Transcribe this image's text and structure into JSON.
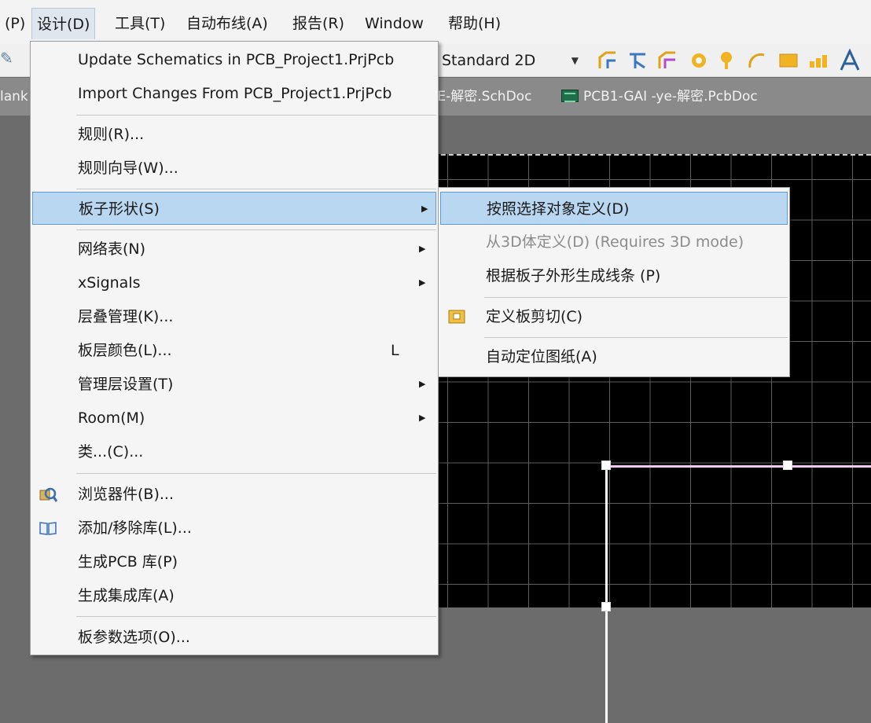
{
  "menubar": {
    "items": [
      {
        "label": "(P)"
      },
      {
        "label": "设计(D)"
      },
      {
        "label": "工具(T)"
      },
      {
        "label": "自动布线(A)"
      },
      {
        "label": "报告(R)"
      },
      {
        "label": "Window"
      },
      {
        "label": "帮助(H)"
      }
    ]
  },
  "toolbar": {
    "view_mode": "Standard 2D",
    "icons": [
      "route-net-icon",
      "route-tee-icon",
      "route-diff-icon",
      "via-icon",
      "pad-icon",
      "arc-icon",
      "fill-icon",
      "region-icon",
      "text-icon"
    ]
  },
  "tabs": {
    "left_fragment": "lank",
    "schdoc": "YE-解密.SchDoc",
    "pcbdoc": "PCB1-GAI -ye-解密.PcbDoc"
  },
  "design_menu": {
    "items": [
      {
        "label": "Update Schematics in PCB_Project1.PrjPcb"
      },
      {
        "label": "Import Changes From PCB_Project1.PrjPcb"
      },
      {
        "label": "规则(R)..."
      },
      {
        "label": "规则向导(W)..."
      },
      {
        "label": "板子形状(S)"
      },
      {
        "label": "网络表(N)"
      },
      {
        "label": "xSignals"
      },
      {
        "label": "层叠管理(K)..."
      },
      {
        "label": "板层颜色(L)...",
        "shortcut": "L"
      },
      {
        "label": "管理层设置(T)"
      },
      {
        "label": "Room(M)"
      },
      {
        "label": "类...(C)..."
      },
      {
        "label": "浏览器件(B)..."
      },
      {
        "label": "添加/移除库(L)..."
      },
      {
        "label": "生成PCB 库(P)"
      },
      {
        "label": "生成集成库(A)"
      },
      {
        "label": "板参数选项(O)..."
      }
    ]
  },
  "board_shape_submenu": {
    "items": [
      {
        "label": "按照选择对象定义(D)"
      },
      {
        "label": "从3D体定义(D) (Requires 3D mode)"
      },
      {
        "label": "根据板子外形生成线条 (P)"
      },
      {
        "label": "定义板剪切(C)"
      },
      {
        "label": "自动定位图纸(A)"
      }
    ]
  },
  "colors": {
    "highlight": "#b9d7f1",
    "highlight_border": "#5d9bd6",
    "board_background": "#000000",
    "board_edge": "#f2c8f0"
  }
}
